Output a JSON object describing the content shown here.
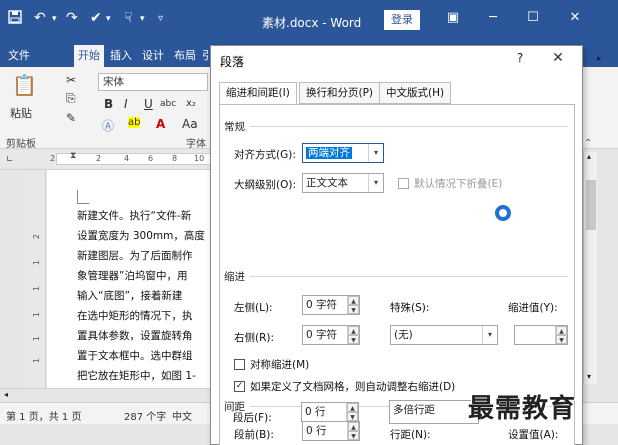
{
  "titlebar": {
    "save_icon": "save-icon",
    "undo_icon": "undo-icon",
    "redo_icon": "redo-icon",
    "title": "素材.docx - Word",
    "login_label": "登录"
  },
  "ribbon_tabs": [
    "文件",
    "开始",
    "插入",
    "设计",
    "布局",
    "引"
  ],
  "ribbon": {
    "paste_label": "粘贴",
    "clipboard_label": "剪贴板",
    "font_name": "宋体",
    "font_group_label": "字体",
    "aa_label": "Aa"
  },
  "ruler_ticks": [
    "2",
    "2",
    "4",
    "6",
    "8",
    "10"
  ],
  "vruler_ticks": [
    "2",
    "1",
    "1",
    "1",
    "1",
    "1",
    "1"
  ],
  "document_lines": [
    "新建文件。执行“文件-新",
    "设置宽度为 300mm，高度",
    "新建图层。为了后面制作",
    "象管理器”泊坞窗中，用",
    "输入“底图”，接着新建",
    "在选中矩形的情况下，执",
    "置具体参数，设置旋转角",
    "置于文本框中。选中群组",
    "把它放在矩形中，如图 1-"
  ],
  "statusbar": {
    "page": "第 1 页，共 1 页",
    "words": "287 个字",
    "lang": "中文"
  },
  "dialog": {
    "title": "段落",
    "help": "?",
    "close": "✕",
    "tabs": [
      "缩进和间距(I)",
      "换行和分页(P)",
      "中文版式(H)"
    ],
    "general": {
      "section": "常规",
      "alignment_label": "对齐方式(G):",
      "alignment_value": "两端对齐",
      "outline_label": "大纲级别(O):",
      "outline_value": "正文文本",
      "collapse_label": "默认情况下折叠(E)"
    },
    "indent": {
      "section": "缩进",
      "left_label": "左侧(L):",
      "left_value": "0 字符",
      "right_label": "右侧(R):",
      "right_value": "0 字符",
      "special_label": "特殊(S):",
      "special_value": "(无)",
      "indent_by_label": "缩进值(Y):",
      "indent_by_value": "",
      "mirror_label": "对称缩进(M)",
      "auto_adjust_label": "如果定义了文档网格，则自动调整右缩进(D)"
    },
    "spacing": {
      "section": "间距",
      "before_label": "段前(B):",
      "before_value": "0 行",
      "after_label": "段后(F):",
      "after_value": "0 行",
      "line_label": "行距(N):",
      "line_value": "多倍行距",
      "at_label": "设置值(A):"
    }
  },
  "watermark": "最需教育",
  "colors": {
    "accent": "#2b579a",
    "selection": "#0078d7",
    "busy": "#1e73d2"
  }
}
